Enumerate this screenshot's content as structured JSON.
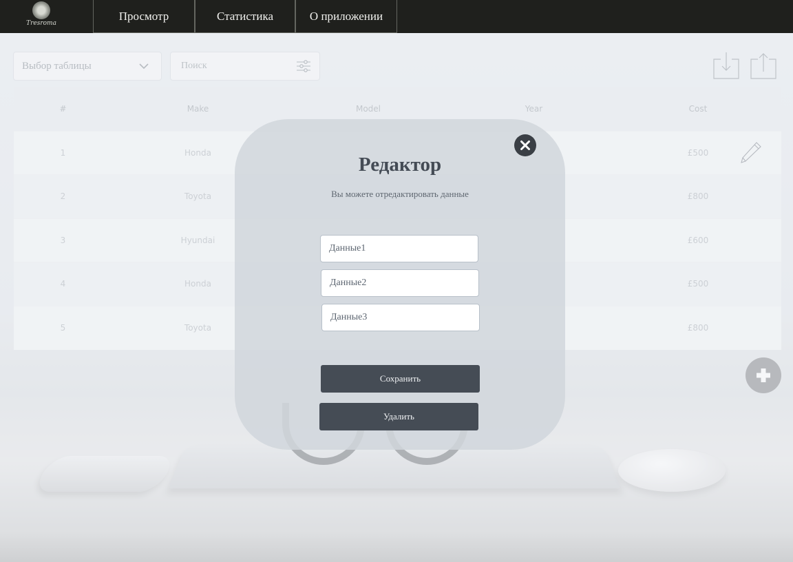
{
  "app": {
    "logo_text": "Tresroma"
  },
  "nav": {
    "tabs": [
      "Просмотр",
      "Статистика",
      "О приложении"
    ]
  },
  "toolbar": {
    "table_select": "Выбор таблицы",
    "search_placeholder": "Поиск"
  },
  "table": {
    "headers": [
      "#",
      "Make",
      "Model",
      "Year",
      "Cost"
    ],
    "rows": [
      {
        "num": "1",
        "make": "Honda",
        "cost": "£500"
      },
      {
        "num": "2",
        "make": "Toyota",
        "cost": "£800"
      },
      {
        "num": "3",
        "make": "Hyundai",
        "cost": "£600"
      },
      {
        "num": "4",
        "make": "Honda",
        "cost": "£500"
      },
      {
        "num": "5",
        "make": "Toyota",
        "cost": "£800"
      }
    ]
  },
  "modal": {
    "title": "Редактор",
    "subtitle": "Вы можете отредактировать данные",
    "fields": [
      "Данные1",
      "Данные2",
      "Данные3"
    ],
    "save_label": "Сохранить",
    "delete_label": "Удалить"
  },
  "icons": {
    "select": "chevron-down-icon",
    "search": "filter-sliders-icon",
    "download": "download-icon",
    "upload": "upload-icon",
    "edit": "pencil-icon",
    "add": "plus-icon",
    "close": "close-icon"
  },
  "colors": {
    "navbar": "#1f201d",
    "modal_button": "#454c55",
    "add_button": "#8d8f92"
  }
}
